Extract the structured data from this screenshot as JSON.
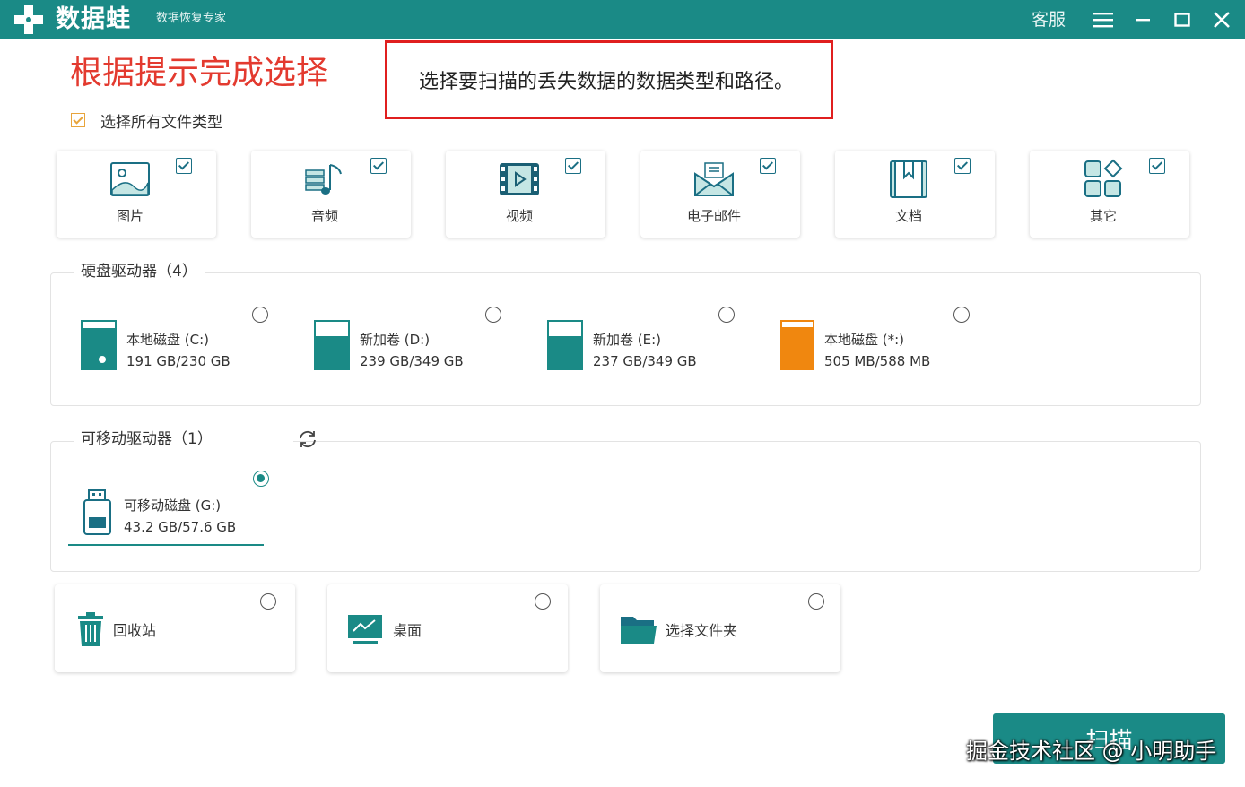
{
  "titlebar": {
    "app_name": "数据蛙",
    "app_subtitle": "数据恢复专家",
    "service_label": "客服"
  },
  "instruction": {
    "heading": "根据提示完成选择",
    "tip_text": "选择要扫描的丢失数据的数据类型和路径。"
  },
  "select_all": {
    "label": "选择所有文件类型",
    "checked": true
  },
  "file_types": [
    {
      "label": "图片",
      "icon": "image-icon",
      "checked": true
    },
    {
      "label": "音频",
      "icon": "music-icon",
      "checked": true
    },
    {
      "label": "视频",
      "icon": "video-icon",
      "checked": true
    },
    {
      "label": "电子邮件",
      "icon": "mail-icon",
      "checked": true
    },
    {
      "label": "文档",
      "icon": "document-icon",
      "checked": true
    },
    {
      "label": "其它",
      "icon": "other-icon",
      "checked": true
    }
  ],
  "hard_drives": {
    "title": "硬盘驱动器（4）",
    "drives": [
      {
        "name": "本地磁盘 (C:)",
        "size": "191 GB/230 GB",
        "used_fraction": 0.83,
        "color": "#1a8a86",
        "selected": false
      },
      {
        "name": "新加卷 (D:)",
        "size": "239 GB/349 GB",
        "used_fraction": 0.68,
        "color": "#1a8a86",
        "selected": false
      },
      {
        "name": "新加卷 (E:)",
        "size": "237 GB/349 GB",
        "used_fraction": 0.68,
        "color": "#1a8a86",
        "selected": false
      },
      {
        "name": "本地磁盘 (*:)",
        "size": "505 MB/588 MB",
        "used_fraction": 0.86,
        "color": "#f0870f",
        "selected": false
      }
    ]
  },
  "removable_drives": {
    "title": "可移动驱动器（1）",
    "drives": [
      {
        "name": "可移动磁盘 (G:)",
        "size": "43.2 GB/57.6 GB",
        "selected": true
      }
    ]
  },
  "locations": [
    {
      "label": "回收站",
      "icon": "trash-icon",
      "selected": false
    },
    {
      "label": "桌面",
      "icon": "desktop-icon",
      "selected": false
    },
    {
      "label": "选择文件夹",
      "icon": "folder-icon",
      "selected": false
    }
  ],
  "scan_button": {
    "label": "扫描"
  },
  "watermark": "掘金技术社区 @ 小明助手",
  "colors": {
    "brand": "#1a8a86",
    "highlight_red": "#e01f1f",
    "orange": "#f0870f"
  }
}
